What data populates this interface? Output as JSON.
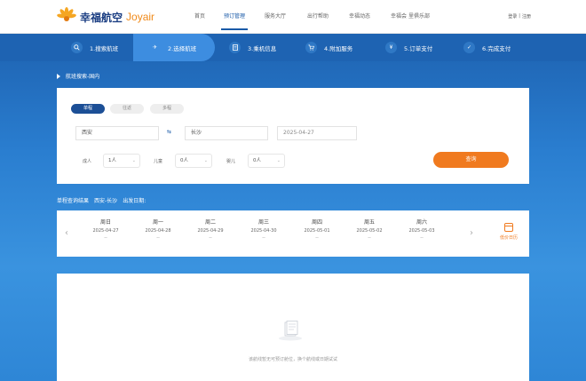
{
  "brand": {
    "name_cn": "幸福航空",
    "name_en": "Joyair"
  },
  "nav": [
    "首页",
    "预订管理",
    "服务大厅",
    "出行帮助",
    "幸福动态",
    "幸福会 里俱乐部"
  ],
  "user_links": {
    "login": "登录",
    "sep": "|",
    "register": "注册"
  },
  "steps": [
    "1.搜索航班",
    "2.选择航班",
    "3.乘机信息",
    "4.附加服务",
    "5.订单支付",
    "6.完成支付"
  ],
  "section_title": "航班搜索-国内",
  "trip_types": [
    "单程",
    "往返",
    "多程"
  ],
  "search": {
    "from": "西安",
    "swap": "⇆",
    "to": "长沙",
    "date": "2025-04-27",
    "adult_label": "成人",
    "adult_value": "1人",
    "child_label": "儿童",
    "child_value": "0人",
    "infant_label": "婴儿",
    "infant_value": "0人",
    "search_button": "查询"
  },
  "result_header": {
    "label": "单程查询结果",
    "route": "西安-长沙",
    "date_label": "出发日期:"
  },
  "days": [
    {
      "week": "周日",
      "date": "2025-04-27",
      "price": "--"
    },
    {
      "week": "周一",
      "date": "2025-04-28",
      "price": "--"
    },
    {
      "week": "周二",
      "date": "2025-04-29",
      "price": "--"
    },
    {
      "week": "周三",
      "date": "2025-04-30",
      "price": "--"
    },
    {
      "week": "周四",
      "date": "2025-05-01",
      "price": "--"
    },
    {
      "week": "周五",
      "date": "2025-05-02",
      "price": "--"
    },
    {
      "week": "周六",
      "date": "2025-05-03",
      "price": "--"
    }
  ],
  "calendar_label": "低价日历",
  "empty_message": "该航线暂无可预订舱位，换个航线或日期试试",
  "colors": {
    "brand_blue": "#1a5aa8",
    "accent_orange": "#f07a1f"
  }
}
